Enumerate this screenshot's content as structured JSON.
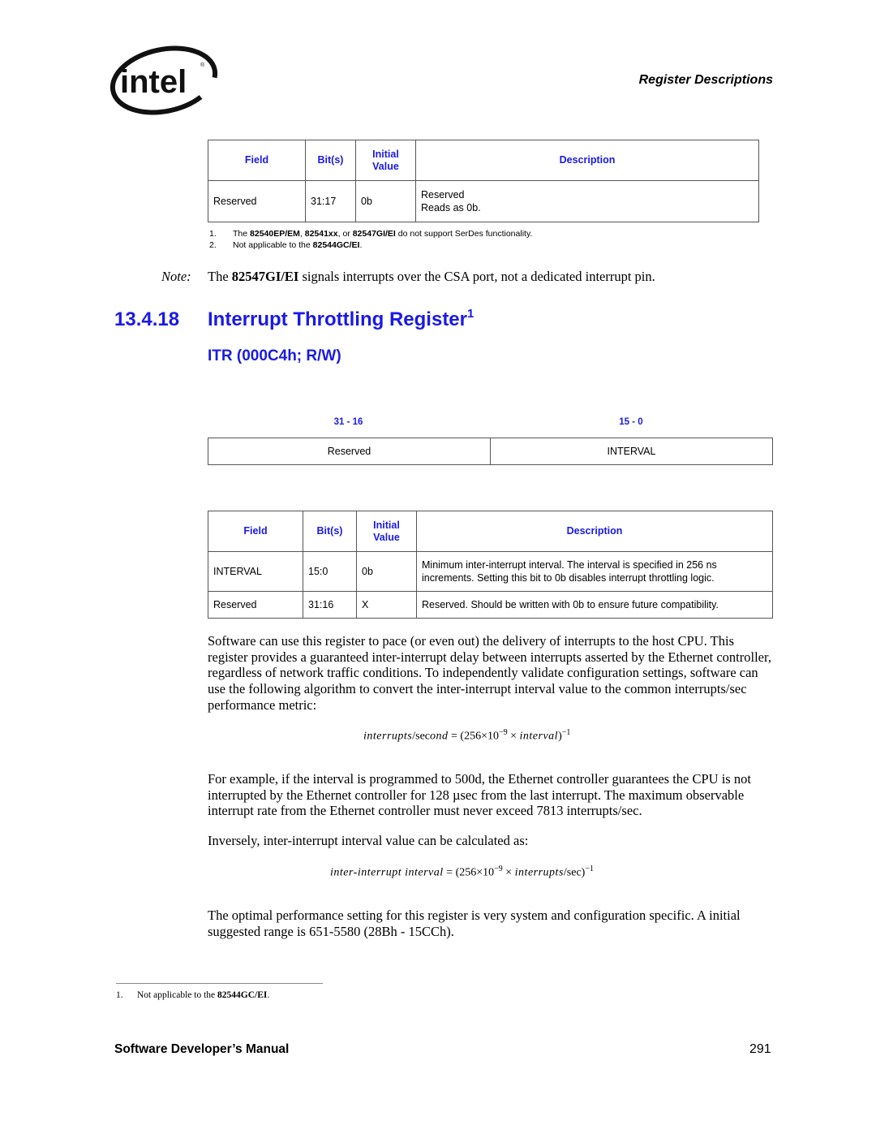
{
  "header": {
    "logo_text": "intel",
    "running_head": "Register Descriptions"
  },
  "table1": {
    "headers": [
      "Field",
      "Bit(s)",
      "Initial Value",
      "Description"
    ],
    "header_initial_line1": "Initial",
    "header_initial_line2": "Value",
    "rows": [
      {
        "field": "Reserved",
        "bits": "31:17",
        "initial": "0b",
        "desc_line1": "Reserved",
        "desc_line2": "Reads as 0b."
      }
    ]
  },
  "table1_footnotes": [
    {
      "num": "1.",
      "pre": "The ",
      "b1": "82540EP/EM",
      "mid1": ", ",
      "b2": "82541xx",
      "mid2": ", or ",
      "b3": "82547GI/EI",
      "post": " do not support SerDes functionality."
    },
    {
      "num": "2.",
      "pre": "Not applicable to the ",
      "b1": "82544GC/EI",
      "post": "."
    }
  ],
  "note": {
    "label": "Note:",
    "pre": "The ",
    "bold": "82547GI/EI",
    "post": " signals interrupts over the CSA port, not a dedicated interrupt pin."
  },
  "section": {
    "number": "13.4.18",
    "title": "Interrupt Throttling Register",
    "footnote_ref": "1",
    "subtitle": "ITR (000C4h; R/W)"
  },
  "bitmap": {
    "ranges": [
      "31 - 16",
      "15 - 0"
    ],
    "fields": [
      "Reserved",
      "INTERVAL"
    ]
  },
  "table2": {
    "headers": [
      "Field",
      "Bit(s)",
      "Initial Value",
      "Description"
    ],
    "header_initial_line1": "Initial",
    "header_initial_line2": "Value",
    "rows": [
      {
        "field": "INTERVAL",
        "bits": "15:0",
        "initial": "0b",
        "desc": "Minimum inter-interrupt interval. The interval is specified in 256 ns increments. Setting this bit to 0b disables interrupt throttling logic."
      },
      {
        "field": "Reserved",
        "bits": "31:16",
        "initial": "X",
        "desc": "Reserved. Should be written with 0b to ensure future compatibility."
      }
    ]
  },
  "body": {
    "para1": "Software can use this register to pace (or even out) the delivery of interrupts to the host CPU. This register provides a guaranteed inter-interrupt delay between interrupts asserted by the Ethernet controller, regardless of network traffic conditions. To independently validate configuration settings, software can use the following algorithm to convert the inter-interrupt interval value to the common interrupts/sec performance metric:",
    "eq1": {
      "lhs_a": "interrupts",
      "lhs_sep": "/",
      "lhs_b": "sec",
      "lhs_c": "ond",
      "eq": " = ",
      "open": "(256×10",
      "exp": "−9",
      "times": " × ",
      "var": "interval",
      "close": ")",
      "outer_exp": "−1"
    },
    "para2": "For example, if the interval is programmed to 500d, the Ethernet controller guarantees the CPU is not interrupted by the Ethernet controller for 128 µsec from the last interrupt. The maximum observable interrupt rate from the Ethernet controller must never exceed 7813 interrupts/sec.",
    "para3": "Inversely, inter-interrupt interval value can be calculated as:",
    "eq2": {
      "lhs": "inter-interrupt interval",
      "eq": " = ",
      "open": "(256×10",
      "exp": "−9",
      "times": " × ",
      "var": "interrupts",
      "var_tail": "/sec)",
      "outer_exp": "−1"
    },
    "para4": "The optimal performance setting for this register is very system and configuration specific. A initial suggested range is 651-5580 (28Bh - 15CCh)."
  },
  "page_footnote": {
    "num": "1.",
    "pre": "Not applicable to the ",
    "bold": "82544GC/EI",
    "post": "."
  },
  "footer": {
    "title": "Software Developer’s Manual",
    "page_number": "291"
  }
}
